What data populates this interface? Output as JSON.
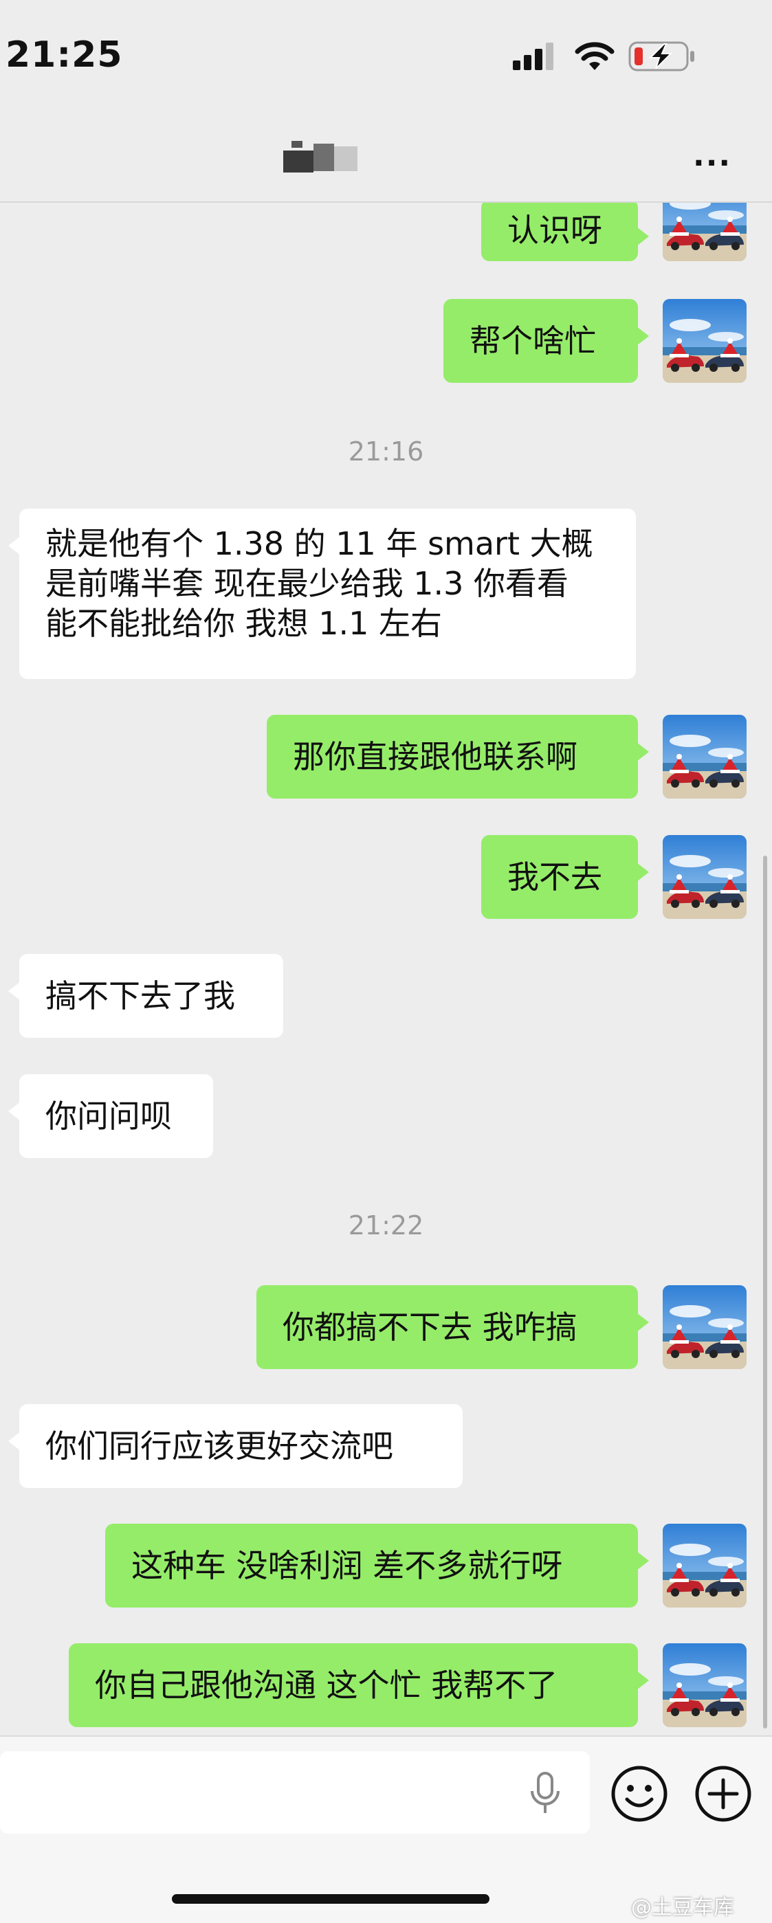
{
  "status_bar": {
    "time": "21:25",
    "icons": [
      "signal-icon",
      "wifi-icon",
      "battery-charging-icon"
    ]
  },
  "header": {
    "title": "",
    "more_label": "···"
  },
  "messages": [
    {
      "side": "out",
      "text": "认识呀"
    },
    {
      "side": "out",
      "text": "帮个啥忙"
    },
    {
      "type": "timestamp",
      "text": "21:16"
    },
    {
      "side": "in",
      "lines": [
        "就是他有个 1.38 的 11 年 smart 大概",
        "是前嘴半套 现在最少给我 1.3 你看看",
        "能不能批给你 我想 1.1 左右"
      ]
    },
    {
      "side": "out",
      "text": "那你直接跟他联系啊"
    },
    {
      "side": "out",
      "text": "我不去"
    },
    {
      "side": "in",
      "text": "搞不下去了我"
    },
    {
      "side": "in",
      "text": "你问问呗"
    },
    {
      "type": "timestamp",
      "text": "21:22"
    },
    {
      "side": "out",
      "text": "你都搞不下去 我咋搞"
    },
    {
      "side": "in",
      "text": "你们同行应该更好交流吧"
    },
    {
      "side": "out",
      "text": "这种车 没啥利润 差不多就行呀"
    },
    {
      "side": "out",
      "text": "你自己跟他沟通 这个忙 我帮不了"
    }
  ],
  "input": {
    "placeholder": ""
  },
  "watermark": "@土豆车库",
  "colors": {
    "outgoing_bubble": "#95EC69",
    "incoming_bubble": "#FFFFFF",
    "background": "#EDEDED"
  }
}
